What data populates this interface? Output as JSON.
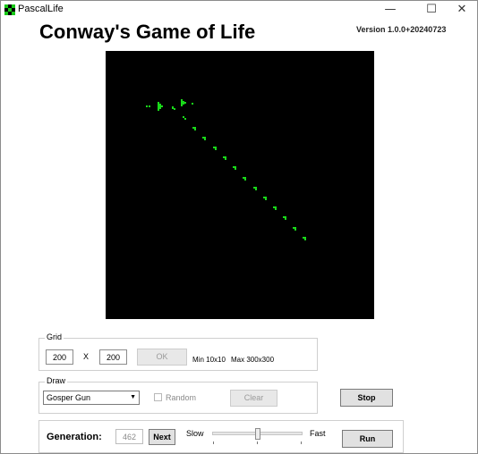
{
  "window": {
    "title": "PascalLife",
    "controls": {
      "minimize": "—",
      "maximize": "☐",
      "close": "✕"
    }
  },
  "header": {
    "title": "Conway's Game of Life",
    "version": "Version 1.0.0+20240723"
  },
  "board": {
    "background": "#000000",
    "cell_color": "#19d919"
  },
  "grid": {
    "legend": "Grid",
    "width": "200",
    "separator": "X",
    "height": "200",
    "ok_label": "OK",
    "hint_min": "Min 10x10",
    "hint_max": "Max 300x300"
  },
  "draw": {
    "legend": "Draw",
    "pattern": "Gosper Gun",
    "random_label": "Random",
    "random_checked": false,
    "clear_label": "Clear"
  },
  "actions": {
    "stop_label": "Stop",
    "run_label": "Run"
  },
  "generation": {
    "label": "Generation:",
    "value": "462",
    "next_label": "Next",
    "slow_label": "Slow",
    "fast_label": "Fast",
    "speed_fraction": 0.5
  }
}
